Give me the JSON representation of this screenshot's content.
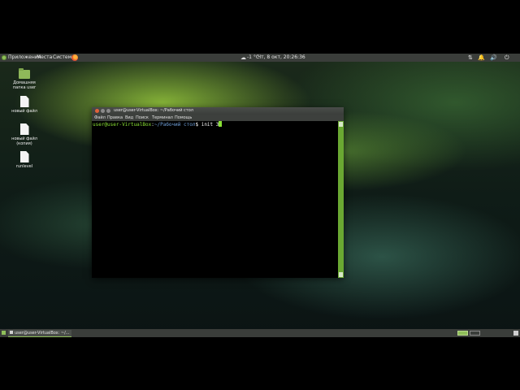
{
  "top_panel": {
    "menus": [
      "Приложения",
      "Места",
      "Система"
    ],
    "weather": "-1 °С",
    "datetime": "Чт, 8 окт, 20:26:36",
    "tray_icons": [
      "network-icon",
      "notifications-icon",
      "volume-icon",
      "power-icon"
    ]
  },
  "desktop_icons": [
    {
      "label": "Домашняя папка user",
      "icon": "folder-icon"
    },
    {
      "label": "новый файл",
      "icon": "file-icon"
    },
    {
      "label": "новый файл (копия)",
      "icon": "file-icon"
    },
    {
      "label": "runlevel",
      "icon": "file-icon"
    }
  ],
  "terminal": {
    "title": "user@user-VirtualBox: ~/Рабочий стол",
    "menu": [
      "Файл",
      "Правка",
      "Вид",
      "Поиск",
      "Терминал",
      "Помощь"
    ],
    "prompt_user": "user@user-VirtualBox",
    "prompt_sep": ":",
    "prompt_path": "~/Рабочий стол",
    "prompt_end": "$",
    "command": "init 3"
  },
  "bottom_panel": {
    "task_label": "user@user-VirtualBox: ~/..."
  },
  "colors": {
    "accent": "#8fbf5a",
    "panel": "#3a3d3a",
    "prompt_green": "#8ae234",
    "prompt_blue": "#6f9fd8"
  }
}
